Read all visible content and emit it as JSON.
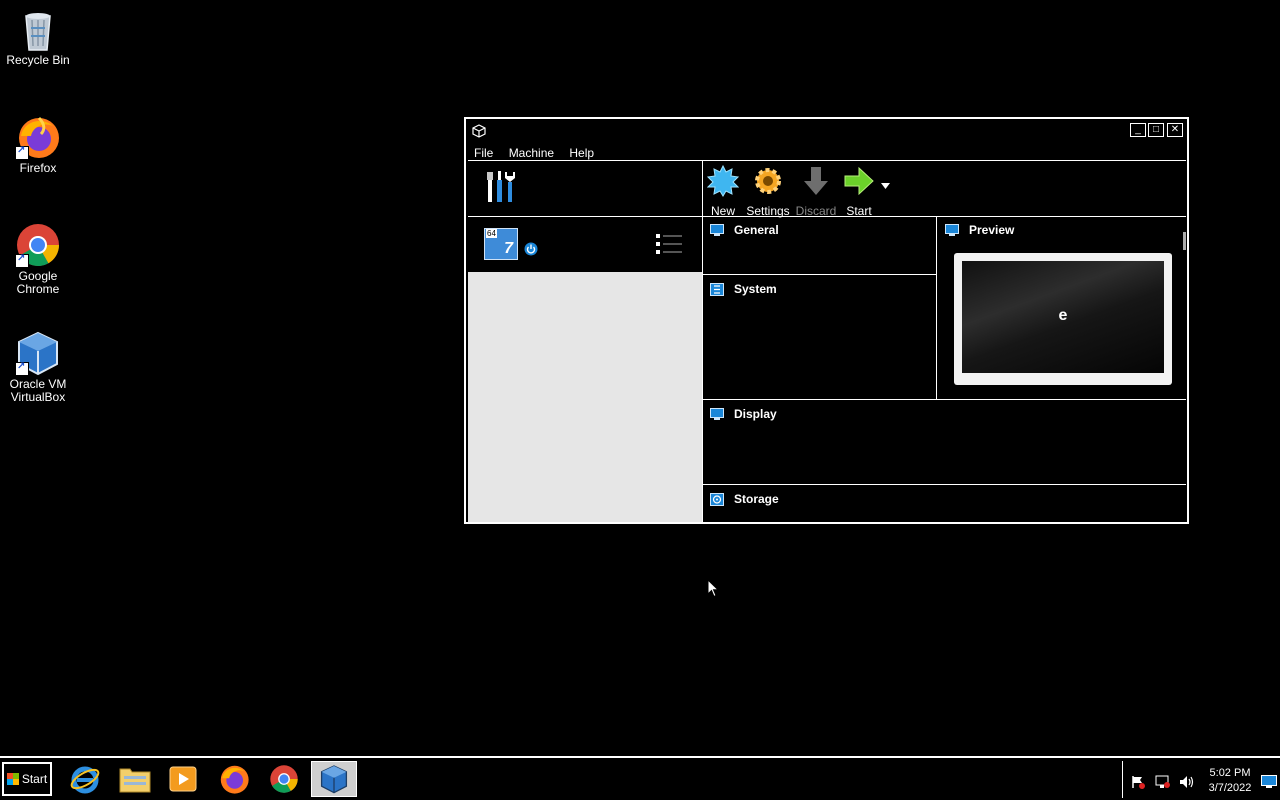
{
  "desktop": {
    "icons": [
      {
        "label": "Recycle Bin"
      },
      {
        "label": "Firefox"
      },
      {
        "label": "Google Chrome"
      },
      {
        "label": "Oracle VM VirtualBox"
      }
    ]
  },
  "window": {
    "menu": [
      "File",
      "Machine",
      "Help"
    ],
    "toolbar": [
      {
        "label": "New",
        "enabled": true
      },
      {
        "label": "Settings",
        "enabled": true
      },
      {
        "label": "Discard",
        "enabled": false
      },
      {
        "label": "Start",
        "enabled": true
      }
    ],
    "vm_badge": "64",
    "vm_version_glyph": "7",
    "sections": {
      "general": "General",
      "system": "System",
      "preview": "Preview",
      "display": "Display",
      "storage": "Storage"
    },
    "preview_text": "e"
  },
  "taskbar": {
    "start_label": "Start",
    "clock_time": "5:02 PM",
    "clock_date": "3/7/2022"
  },
  "colors": {
    "desktop_bg": "#000000",
    "list_bg": "#e6e6e6",
    "accent_blue": "#1a86d8",
    "start_arrow": "#6bd12a",
    "settings_gear": "#f5a623"
  }
}
